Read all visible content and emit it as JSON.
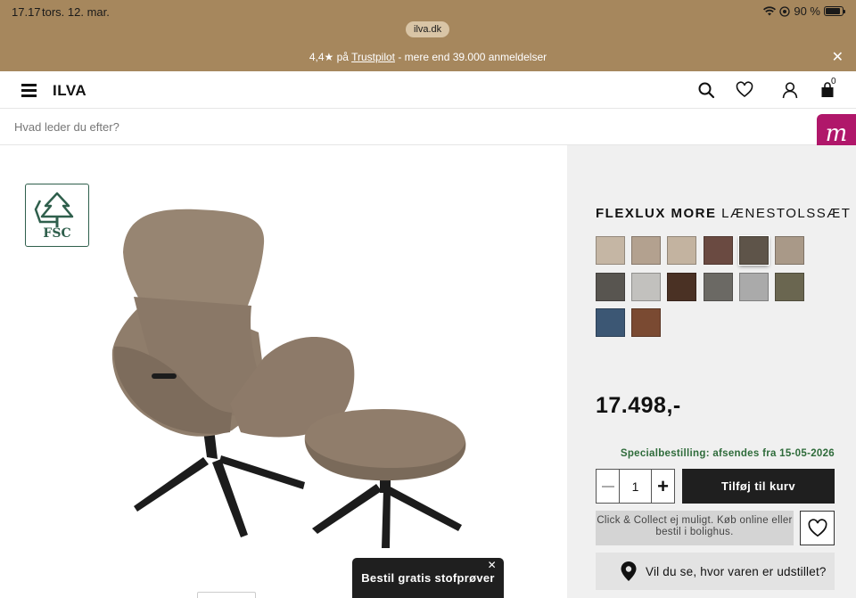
{
  "status": {
    "time": "17.17",
    "date": "tors. 12. mar.",
    "battery": "90 %"
  },
  "browser": {
    "url": "ilva.dk"
  },
  "promo": {
    "rating": "4,4★ på ",
    "link": "Trustpilot",
    "rest": " - mere end 39.000 anmeldelser"
  },
  "header": {
    "logo": "ILVA",
    "cart_count": "0"
  },
  "search": {
    "placeholder": "Hvad leder du efter?"
  },
  "badge": {
    "letter": "m"
  },
  "gallery": {
    "fsc_label": "FSC",
    "sample_button": "Bestil gratis stofprøver"
  },
  "product": {
    "title_brand": "FLEXLUX MORE",
    "title_rest": " LÆNESTOLSSÆT",
    "price": "17.498,-",
    "delivery": "Specialbestilling: afsendes fra 15-05-2026",
    "quantity": "1",
    "add_to_cart": "Tilføj til kurv",
    "click_collect": "Click & Collect ej muligt. Køb online eller bestil i bolighus.",
    "showroom": "Vil du se, hvor varen er udstillet?"
  },
  "swatches": [
    {
      "color": "#c5b6a4",
      "selected": false
    },
    {
      "color": "#b3a18f",
      "selected": false
    },
    {
      "color": "#c3b3a0",
      "selected": false
    },
    {
      "color": "#6a4a41",
      "selected": false
    },
    {
      "color": "#5e5449",
      "selected": true
    },
    {
      "color": "#a99988",
      "selected": false
    },
    {
      "color": "#585550",
      "selected": false
    },
    {
      "color": "#c2c1be",
      "selected": false
    },
    {
      "color": "#4a3124",
      "selected": false
    },
    {
      "color": "#6b6964",
      "selected": false
    },
    {
      "color": "#aaaaaa",
      "selected": false
    },
    {
      "color": "#6a6650",
      "selected": false
    },
    {
      "color": "#3c5774",
      "selected": false
    },
    {
      "color": "#7a4a32",
      "selected": false
    }
  ]
}
